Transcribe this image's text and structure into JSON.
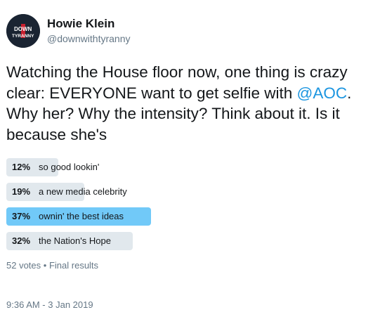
{
  "author": {
    "name": "Howie Klein",
    "handle": "@downwithtyranny",
    "avatar_icon": "down-with-tyranny-logo",
    "avatar_text_top": "DOWN",
    "avatar_text_bottom": "TYRANNY"
  },
  "tweet": {
    "text_before": "Watching the House floor now, one thing is crazy clear: EVERYONE want to get selfie with ",
    "mention": "@AOC",
    "text_after": ". Why her? Why the intensity? Think about it. Is it because she's"
  },
  "poll": {
    "options": [
      {
        "percent": "12%",
        "fraction": 0.12,
        "label": "so good lookin'"
      },
      {
        "percent": "19%",
        "fraction": 0.19,
        "label": "a new media celebrity"
      },
      {
        "percent": "37%",
        "fraction": 0.37,
        "label": "ownin' the best ideas",
        "winner": true
      },
      {
        "percent": "32%",
        "fraction": 0.32,
        "label": "the Nation's Hope"
      }
    ],
    "votes": "52 votes",
    "separator": "•",
    "status": "Final results"
  },
  "timestamp": "9:36 AM - 3 Jan 2019",
  "colors": {
    "mention": "#1b95e0",
    "winner_bar": "#71c9f8",
    "bar": "#e1e8ed",
    "secondary_text": "#657786"
  }
}
